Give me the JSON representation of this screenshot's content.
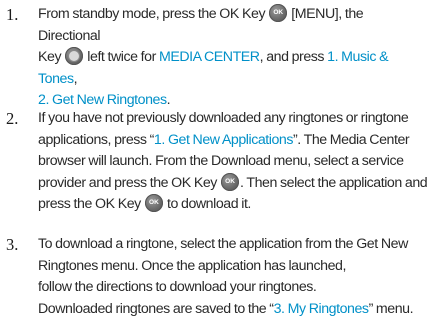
{
  "steps": [
    {
      "number": "1.",
      "parts": {
        "a": "From standby mode, press the OK Key",
        "key_ok_label": "OK",
        "b": "[MENU], the Directional",
        "c": "Key",
        "d": "left twice for",
        "e": "MEDIA CENTER",
        "f": ", and press",
        "g": "1. Music & Tones",
        "h": ",",
        "i": "2. Get New Ringtones",
        "j": "."
      }
    },
    {
      "number": "2.",
      "parts": {
        "a": "If you have not previously downloaded any ringtones or ringtone applications, press “",
        "b": "1. Get New Applications",
        "c": "”. The Media Center browser will launch. From the Download menu, select a service provider and press the OK Key",
        "key_ok_label": "OK",
        "d": ". Then select the application and press the OK Key",
        "e": "to download it."
      }
    },
    {
      "number": "3.",
      "parts": {
        "a": "To download a ringtone, select the application from the Get New Ringtones menu. Once the application has launched,",
        "b": "follow the directions to download your ringtones.",
        "c": "Downloaded ringtones are saved to the “",
        "d": "3. My Ringtones",
        "e": "” menu."
      }
    }
  ],
  "colors": {
    "highlight": "#0090c8",
    "body_text": "#2a2a2a"
  },
  "icons": [
    "ok-key-icon",
    "directional-key-icon"
  ]
}
